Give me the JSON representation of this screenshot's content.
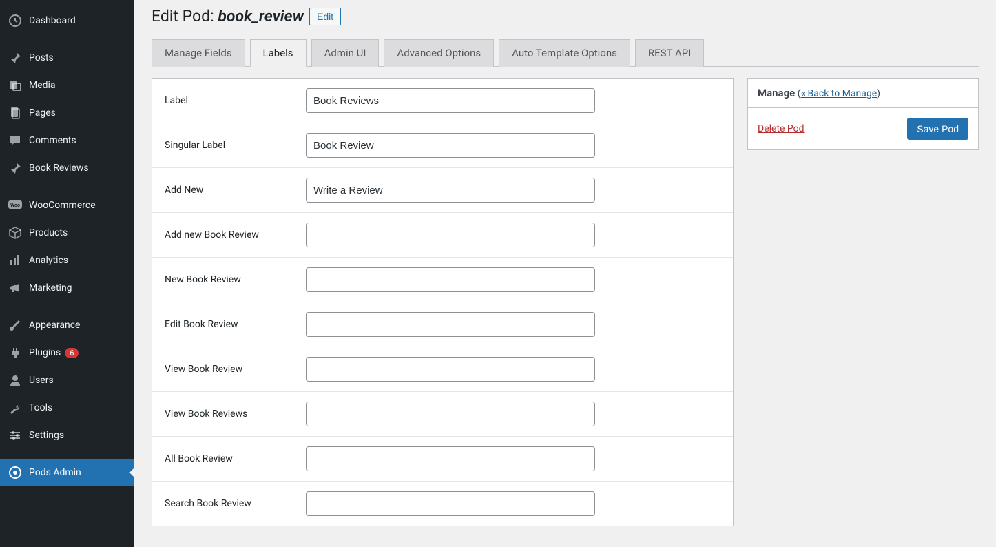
{
  "sidebar": {
    "items": [
      {
        "label": "Dashboard"
      },
      {
        "label": "Posts"
      },
      {
        "label": "Media"
      },
      {
        "label": "Pages"
      },
      {
        "label": "Comments"
      },
      {
        "label": "Book Reviews"
      },
      {
        "label": "WooCommerce"
      },
      {
        "label": "Products"
      },
      {
        "label": "Analytics"
      },
      {
        "label": "Marketing"
      },
      {
        "label": "Appearance"
      },
      {
        "label": "Plugins"
      },
      {
        "label": "Users"
      },
      {
        "label": "Tools"
      },
      {
        "label": "Settings"
      },
      {
        "label": "Pods Admin"
      }
    ],
    "plugin_badge": "6"
  },
  "header": {
    "title_prefix": "Edit Pod: ",
    "pod_name": "book_review",
    "edit_button": "Edit"
  },
  "tabs": [
    {
      "label": "Manage Fields"
    },
    {
      "label": "Labels"
    },
    {
      "label": "Admin UI"
    },
    {
      "label": "Advanced Options"
    },
    {
      "label": "Auto Template Options"
    },
    {
      "label": "REST API"
    }
  ],
  "form": {
    "rows": [
      {
        "label": "Label",
        "value": "Book Reviews"
      },
      {
        "label": "Singular Label",
        "value": "Book Review"
      },
      {
        "label": "Add New",
        "value": "Write a Review"
      },
      {
        "label": "Add new Book Review",
        "value": ""
      },
      {
        "label": "New Book Review",
        "value": ""
      },
      {
        "label": "Edit Book Review",
        "value": ""
      },
      {
        "label": "View Book Review",
        "value": ""
      },
      {
        "label": "View Book Reviews",
        "value": ""
      },
      {
        "label": "All Book Review",
        "value": ""
      },
      {
        "label": "Search Book Review",
        "value": ""
      }
    ]
  },
  "side": {
    "title": "Manage",
    "back_link": "« Back to Manage",
    "delete": "Delete Pod",
    "save": "Save Pod"
  }
}
